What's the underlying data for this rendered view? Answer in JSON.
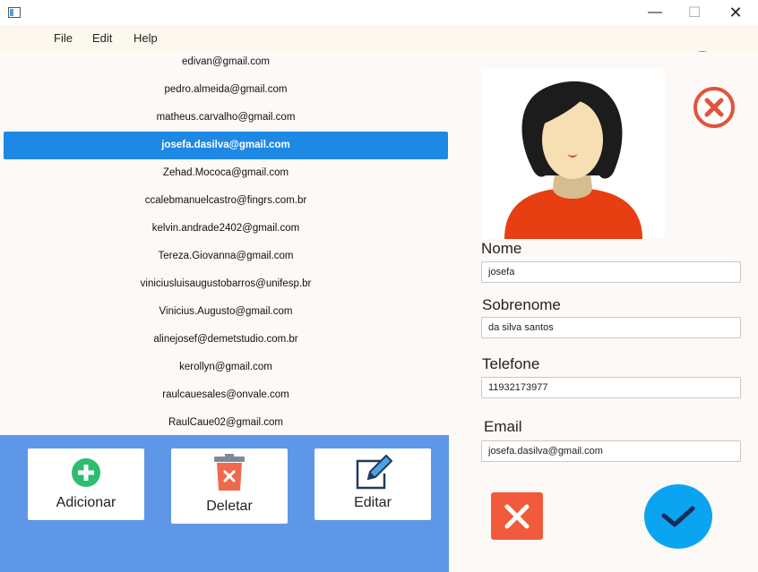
{
  "window": {
    "minimize_glyph": "—",
    "maximize_glyph": "☐",
    "close_glyph": "✕"
  },
  "menu": {
    "items": [
      {
        "label": "File"
      },
      {
        "label": "Edit"
      },
      {
        "label": "Help"
      }
    ]
  },
  "theme_toggle": {
    "icon": "moon-icon",
    "state": "off"
  },
  "emails": [
    "edivan@gmail.com",
    "pedro.almeida@gmail.com",
    "matheus.carvalho@gmail.com",
    "josefa.dasilva@gmail.com",
    "Zehad.Mococa@gmail.com",
    "ccalebmanuelcastro@fingrs.com.br",
    "kelvin.andrade2402@gmail.com",
    "Tereza.Giovanna@gmail.com",
    "viniciusluisaugustobarros@unifesp.br",
    "Vinicius.Augusto@gmail.com",
    "alinejosef@demetstudio.com.br",
    "kerollyn@gmail.com",
    "raulcauesales@onvale.com",
    "RaulCaue02@gmail.com"
  ],
  "selected_email": "josefa.dasilva@gmail.com",
  "actions": {
    "add_label": "Adicionar",
    "delete_label": "Deletar",
    "edit_label": "Editar"
  },
  "form": {
    "nome_label": "Nome",
    "nome_value": "josefa",
    "sobrenome_label": "Sobrenome",
    "sobrenome_value": "da silva santos",
    "telefone_label": "Telefone",
    "telefone_value": "11932173977",
    "email_label": "Email",
    "email_value": "josefa.dasilva@gmail.com"
  },
  "colors": {
    "selection": "#1e88e5",
    "bottom_panel": "#5f97e8",
    "cancel": "#f15a3a",
    "confirm": "#0aa4f0",
    "add_icon": "#2dbd6e",
    "delete_icon": "#ee6a4e"
  }
}
